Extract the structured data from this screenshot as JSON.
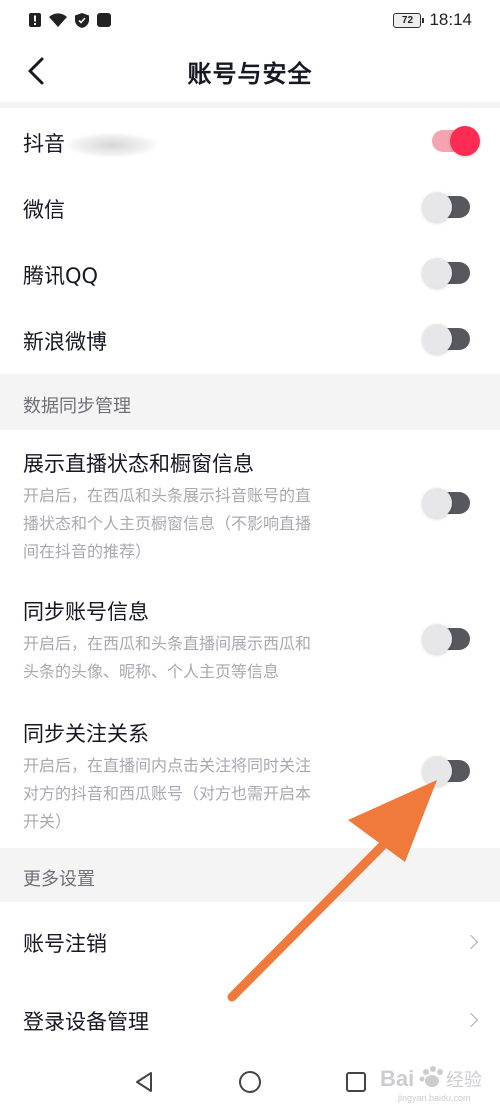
{
  "status_bar": {
    "battery_level": "72",
    "time": "18:14"
  },
  "header": {
    "title": "账号与安全",
    "back_icon": "chevron-left-icon"
  },
  "bindings": [
    {
      "label": "抖音",
      "enabled": true,
      "name_redacted": true
    },
    {
      "label": "微信",
      "enabled": false
    },
    {
      "label": "腾讯QQ",
      "enabled": false
    },
    {
      "label": "新浪微博",
      "enabled": false
    }
  ],
  "sync_section": {
    "title": "数据同步管理",
    "items": [
      {
        "title": "展示直播状态和橱窗信息",
        "desc_lines": [
          "开启后，在西瓜和头条展示抖音账号的直",
          "播状态和个人主页橱窗信息（不影响直播",
          "间在抖音的推荐）"
        ],
        "enabled": false
      },
      {
        "title": "同步账号信息",
        "desc_lines": [
          "开启后，在西瓜和头条直播间展示西瓜和",
          "头条的头像、昵称、个人主页等信息"
        ],
        "enabled": false
      },
      {
        "title": "同步关注关系",
        "desc_lines": [
          "开启后，在直播间内点击关注将同时关注",
          "对方的抖音和西瓜账号（对方也需开启本",
          "开关）"
        ],
        "enabled": false
      }
    ]
  },
  "more_section": {
    "title": "更多设置",
    "items": [
      {
        "label": "账号注销"
      },
      {
        "label": "登录设备管理"
      }
    ]
  },
  "nav_bar": {
    "back_icon": "triangle-back-icon",
    "home_icon": "circle-home-icon",
    "recents_icon": "square-recents-icon"
  },
  "colors": {
    "accent": "#fe2c55",
    "accent_track": "#f6a4b0",
    "toggle_off_track": "#57575e",
    "section_bg": "#f4f4f5",
    "annotation_arrow": "#f07a3c"
  },
  "watermark": {
    "text": "Bai 经验",
    "sub": "jingyan.baidu.com"
  }
}
